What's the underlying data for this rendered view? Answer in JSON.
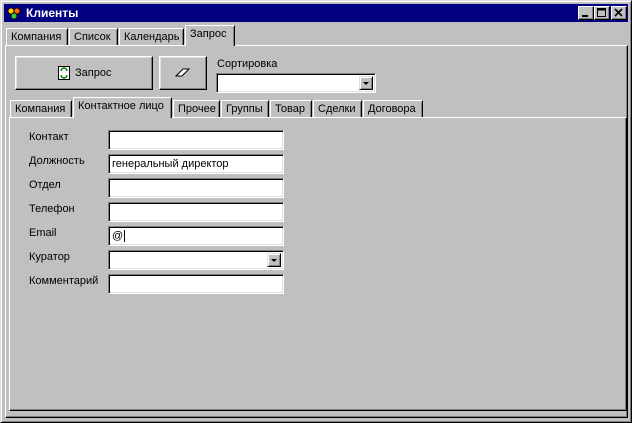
{
  "window": {
    "title": "Клиенты"
  },
  "top_tabs": [
    "Компания",
    "Список",
    "Календарь",
    "Запрос"
  ],
  "toolbar": {
    "query_label": "Запрос",
    "sort_label": "Сортировка",
    "sort_value": ""
  },
  "inner_tabs": [
    "Компания",
    "Контактное лицо",
    "Прочее",
    "Группы",
    "Товар",
    "Сделки",
    "Договора"
  ],
  "form": {
    "contact_label": "Контакт",
    "contact_value": "",
    "position_label": "Должность",
    "position_value": "генеральный директор",
    "department_label": "Отдел",
    "department_value": "",
    "phone_label": "Телефон",
    "phone_value": "",
    "email_label": "Email",
    "email_value": "@",
    "curator_label": "Куратор",
    "curator_value": "",
    "comment_label": "Комментарий",
    "comment_value": ""
  }
}
